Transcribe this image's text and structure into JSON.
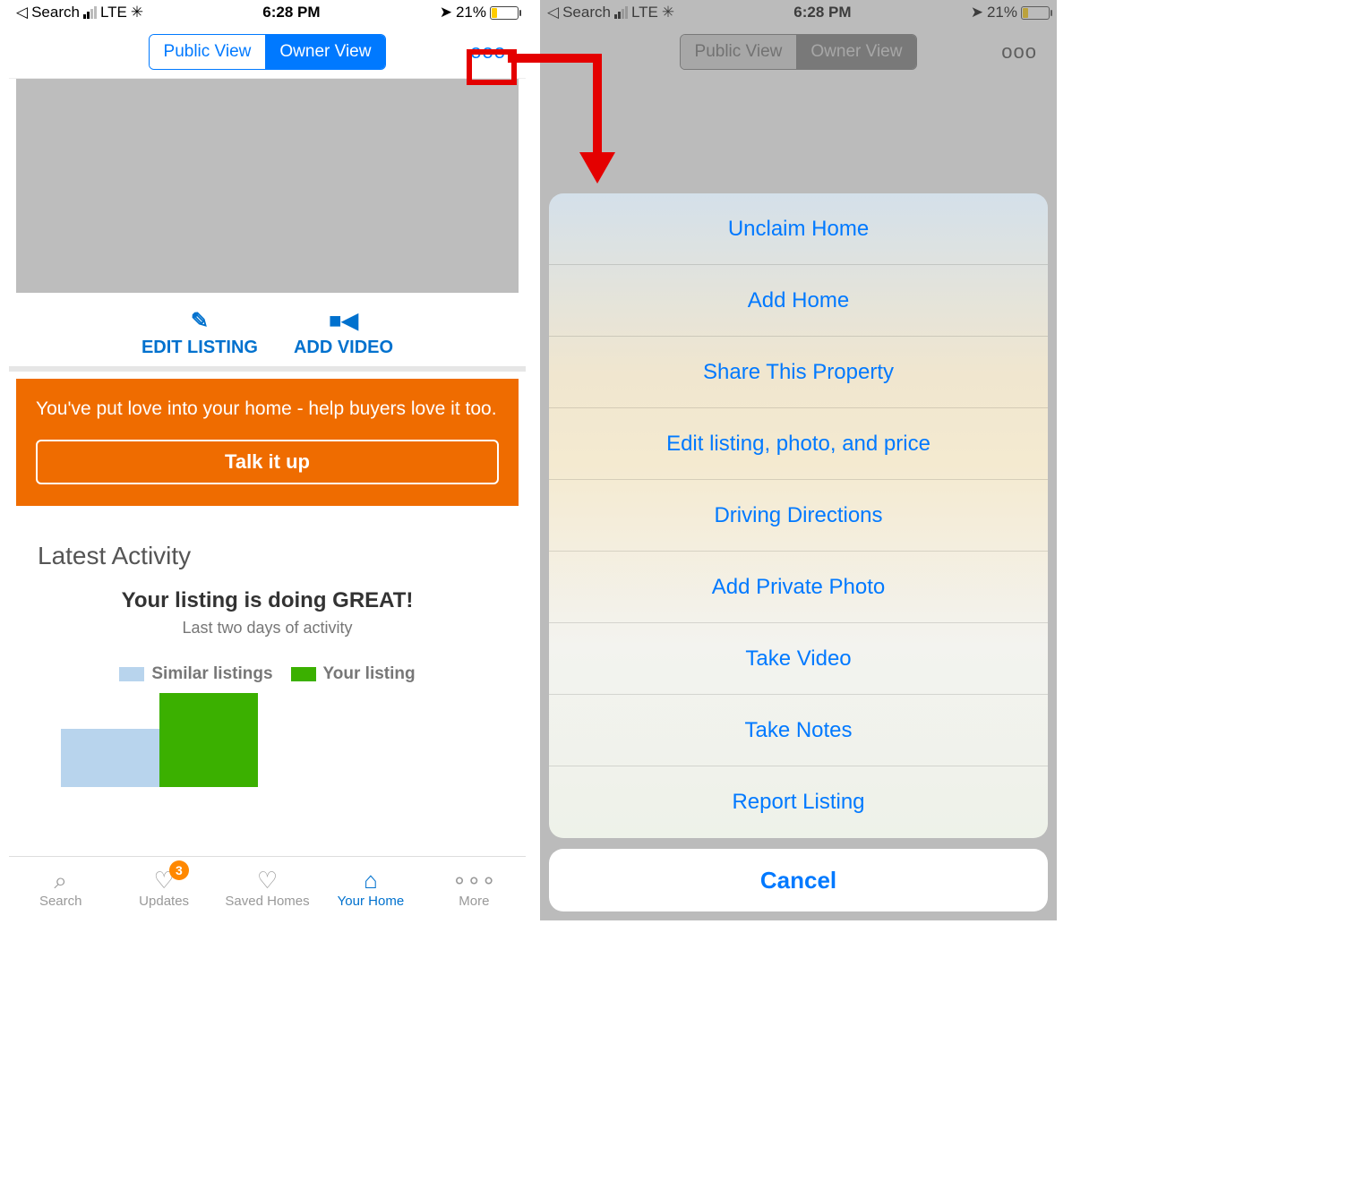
{
  "status": {
    "search": "Search",
    "carrier": "LTE",
    "time": "6:28 PM",
    "battery_pct": "21%"
  },
  "seg": {
    "public": "Public View",
    "owner": "Owner View"
  },
  "more_glyph": "ooo",
  "actions": {
    "edit": "EDIT LISTING",
    "video": "ADD VIDEO"
  },
  "orange": {
    "text": "You've put love into your home - help buyers love it too.",
    "cta": "Talk it up"
  },
  "activity": {
    "heading": "Latest Activity",
    "title": "Your listing is doing GREAT!",
    "subtitle": "Last two days of activity",
    "legend_similar": "Similar listings",
    "legend_your": "Your listing"
  },
  "tabs": {
    "search": "Search",
    "updates": "Updates",
    "updates_badge": "3",
    "saved": "Saved Homes",
    "your": "Your Home",
    "more": "More"
  },
  "sheet": {
    "items": [
      "Unclaim Home",
      "Add Home",
      "Share This Property",
      "Edit listing, photo, and price",
      "Driving Directions",
      "Add Private Photo",
      "Take Video",
      "Take Notes",
      "Report Listing"
    ],
    "cancel": "Cancel"
  },
  "colors": {
    "similar": "#b8d4ed",
    "your": "#3bb000"
  },
  "chart_data": {
    "type": "bar",
    "categories": [
      "Similar listings",
      "Your listing"
    ],
    "values": [
      65,
      105
    ],
    "title": "Your listing is doing GREAT!",
    "subtitle": "Last two days of activity",
    "note": "values are approximate pixel heights; true counts not labeled on chart",
    "series_colors": [
      "#b8d4ed",
      "#3bb000"
    ]
  }
}
